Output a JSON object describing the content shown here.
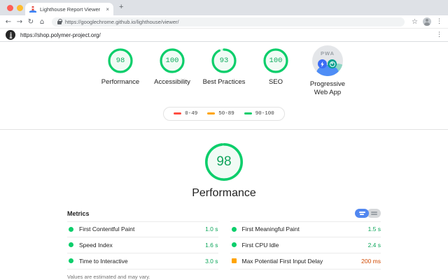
{
  "colors": {
    "pass_green": "#0cce6b",
    "average_orange": "#ffa400",
    "fail_red": "#ff4e42",
    "average_value_text": "#d04900",
    "toggle_active_blue": "#5187f0",
    "tabstrip_gray": "#dee1e6"
  },
  "browser": {
    "tab_title": "Lighthouse Report Viewer",
    "close_tab_glyph": "×",
    "new_tab_glyph": "+",
    "back_glyph": "←",
    "forward_glyph": "→",
    "refresh_glyph": "↻",
    "home_glyph": "⌂",
    "address": "https://googlechrome.github.io/lighthouse/viewer/",
    "star_glyph": "☆",
    "menu_glyph": "⋮"
  },
  "viewer": {
    "page_url": "https://shop.polymer-project.org/",
    "menu_glyph": "⋮"
  },
  "summary": {
    "gauges": [
      {
        "label": "Performance",
        "score": "98",
        "value": 98
      },
      {
        "label": "Accessibility",
        "score": "100",
        "value": 100
      },
      {
        "label": "Best Practices",
        "score": "93",
        "value": 93
      },
      {
        "label": "SEO",
        "score": "100",
        "value": 100
      }
    ],
    "pwa": {
      "badge_text": "PWA",
      "label_line1": "Progressive",
      "label_line2": "Web App"
    }
  },
  "legend": {
    "items": [
      {
        "label": "0-49",
        "color": "#ff4e42"
      },
      {
        "label": "50-89",
        "color": "#ffa400"
      },
      {
        "label": "90-100",
        "color": "#0cce6b"
      }
    ]
  },
  "category": {
    "score": "98",
    "value": 98,
    "label": "Performance"
  },
  "metrics": {
    "title": "Metrics",
    "left": [
      {
        "name": "First Contentful Paint",
        "value": "1.0 s",
        "status": "good"
      },
      {
        "name": "Speed Index",
        "value": "1.6 s",
        "status": "good"
      },
      {
        "name": "Time to Interactive",
        "value": "3.0 s",
        "status": "good"
      }
    ],
    "right": [
      {
        "name": "First Meaningful Paint",
        "value": "1.5 s",
        "status": "good"
      },
      {
        "name": "First CPU Idle",
        "value": "2.4 s",
        "status": "good"
      },
      {
        "name": "Max Potential First Input Delay",
        "value": "200 ms",
        "status": "average"
      }
    ],
    "footnote": "Values are estimated and may vary."
  }
}
